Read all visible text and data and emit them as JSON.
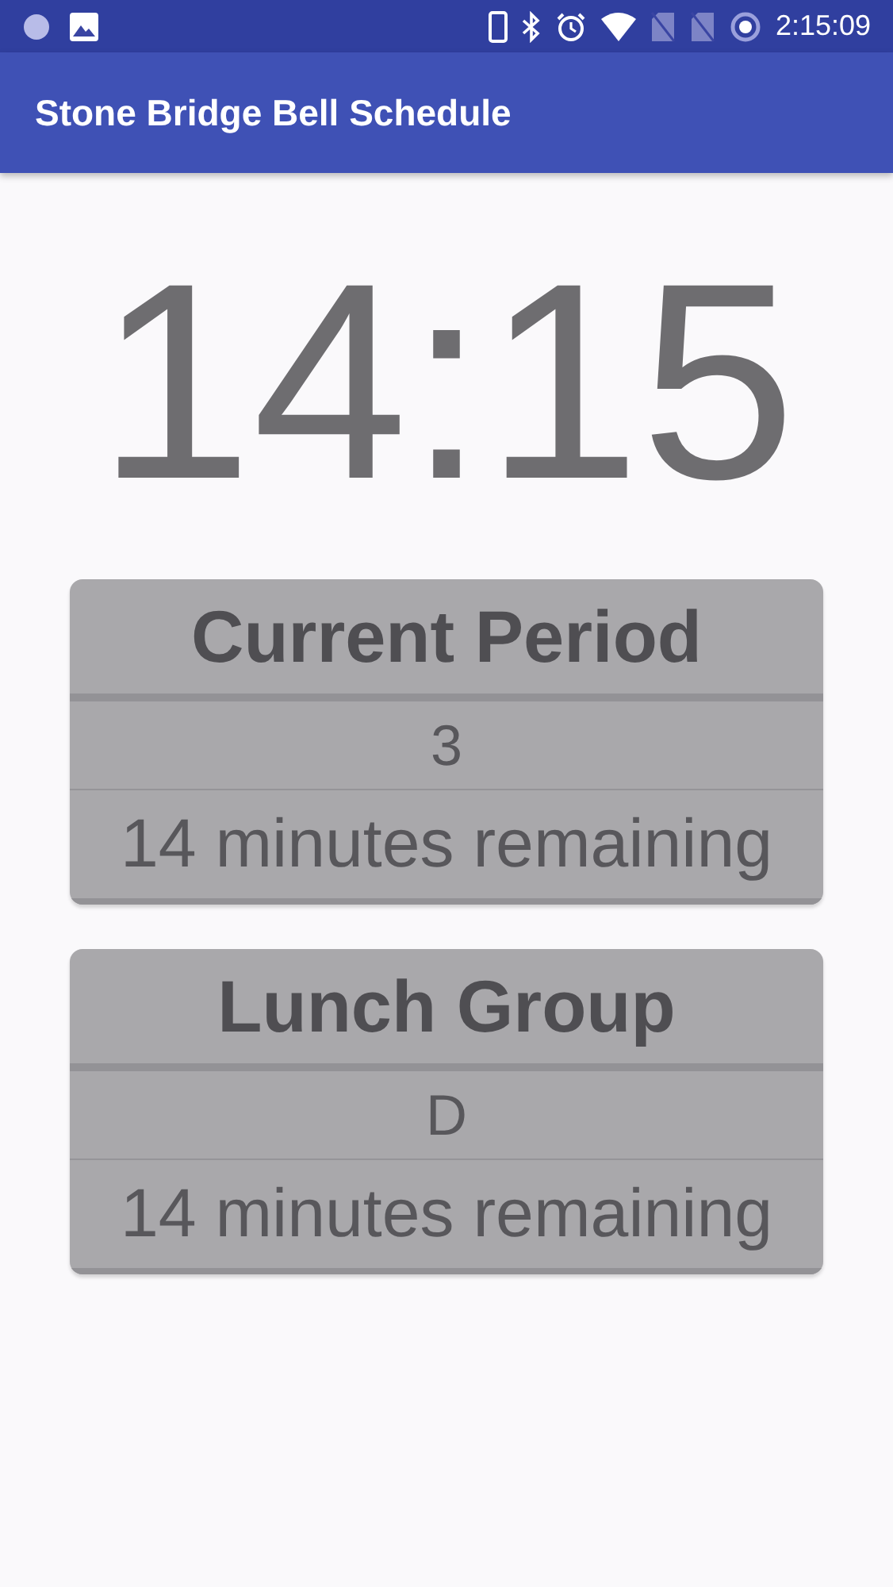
{
  "status_bar": {
    "time": "2:15:09"
  },
  "app_bar": {
    "title": "Stone Bridge Bell Schedule"
  },
  "clock": "14:15",
  "cards": [
    {
      "title": "Current Period",
      "value": "3",
      "remaining": "14 minutes remaining"
    },
    {
      "title": "Lunch Group",
      "value": "D",
      "remaining": "14 minutes remaining"
    }
  ]
}
